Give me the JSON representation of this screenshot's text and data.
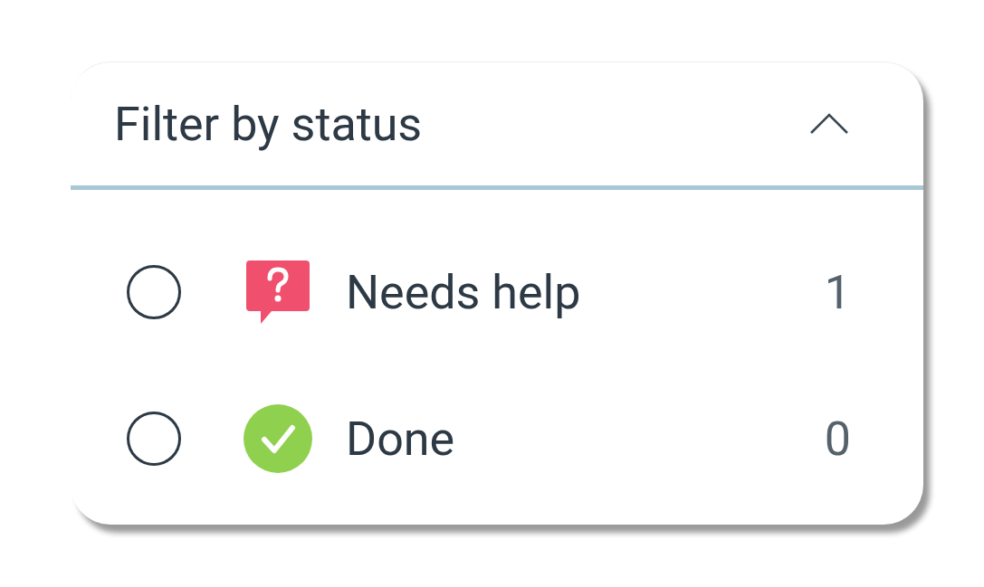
{
  "panel": {
    "title": "Filter by status",
    "expanded": true
  },
  "statuses": [
    {
      "kind": "help",
      "label": "Needs help",
      "count": "1",
      "selected": false
    },
    {
      "kind": "done",
      "label": "Done",
      "count": "0",
      "selected": false
    }
  ]
}
